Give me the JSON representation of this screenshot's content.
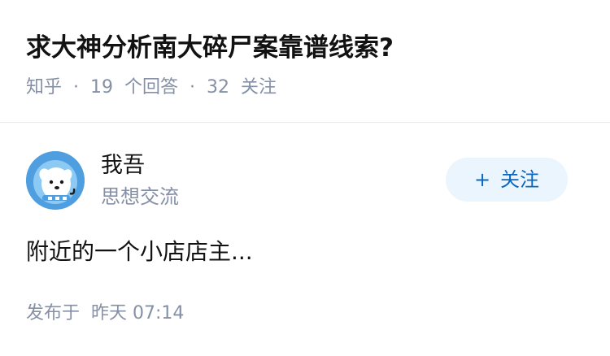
{
  "question": {
    "title": "求大神分析南大碎尸案靠谱线索?",
    "source": "知乎",
    "answers_count": "19",
    "answers_label": "个回答",
    "followers_count": "32",
    "followers_label": "关注",
    "separator": "·"
  },
  "author": {
    "name": "我吾",
    "description": "思想交流",
    "avatar_icon": "zhihu-mascot-avatar-icon",
    "follow_label": "关注",
    "follow_icon": "plus-icon",
    "follow_symbol": "+"
  },
  "answer": {
    "excerpt": "附近的一个小店店主..."
  },
  "post": {
    "published_label": "发布于",
    "time": "昨天 07:14"
  },
  "colors": {
    "title": "#121212",
    "meta": "#8590a6",
    "follow_bg": "#ebf5fd",
    "follow_text": "#0a66c2",
    "avatar_bg": "#4f9fe0"
  }
}
